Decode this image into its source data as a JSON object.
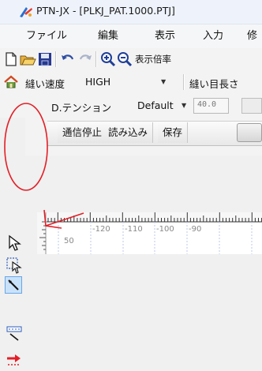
{
  "window": {
    "title": "PTN-JX - [PLKJ_PAT.1000.PTJ]"
  },
  "menu": [
    "ファイル",
    "編集",
    "表示",
    "入力",
    "修"
  ],
  "toolbar1": {
    "icons": [
      "new-document-icon",
      "open-folder-icon",
      "save-icon",
      "undo-icon",
      "redo-icon",
      "zoom-in-icon",
      "zoom-out-icon"
    ],
    "zoom_label": "表示倍率"
  },
  "toolbar2": {
    "speed_label": "縫い速度",
    "speed_value": "HIGH",
    "stitch_length_label": "縫い目長さ"
  },
  "toolbar3": {
    "tension_label": "D.テンション",
    "tension_value": "Default",
    "tension_number": "40.0"
  },
  "toolbar4": {
    "buttons": [
      "通信停止",
      "読み込み",
      "保存"
    ]
  },
  "ruler": {
    "top_labels": [
      "-120",
      "-110",
      "-100",
      "-90"
    ],
    "left_label": "50"
  },
  "annotation": {
    "highlight_color": "#e41e26"
  }
}
